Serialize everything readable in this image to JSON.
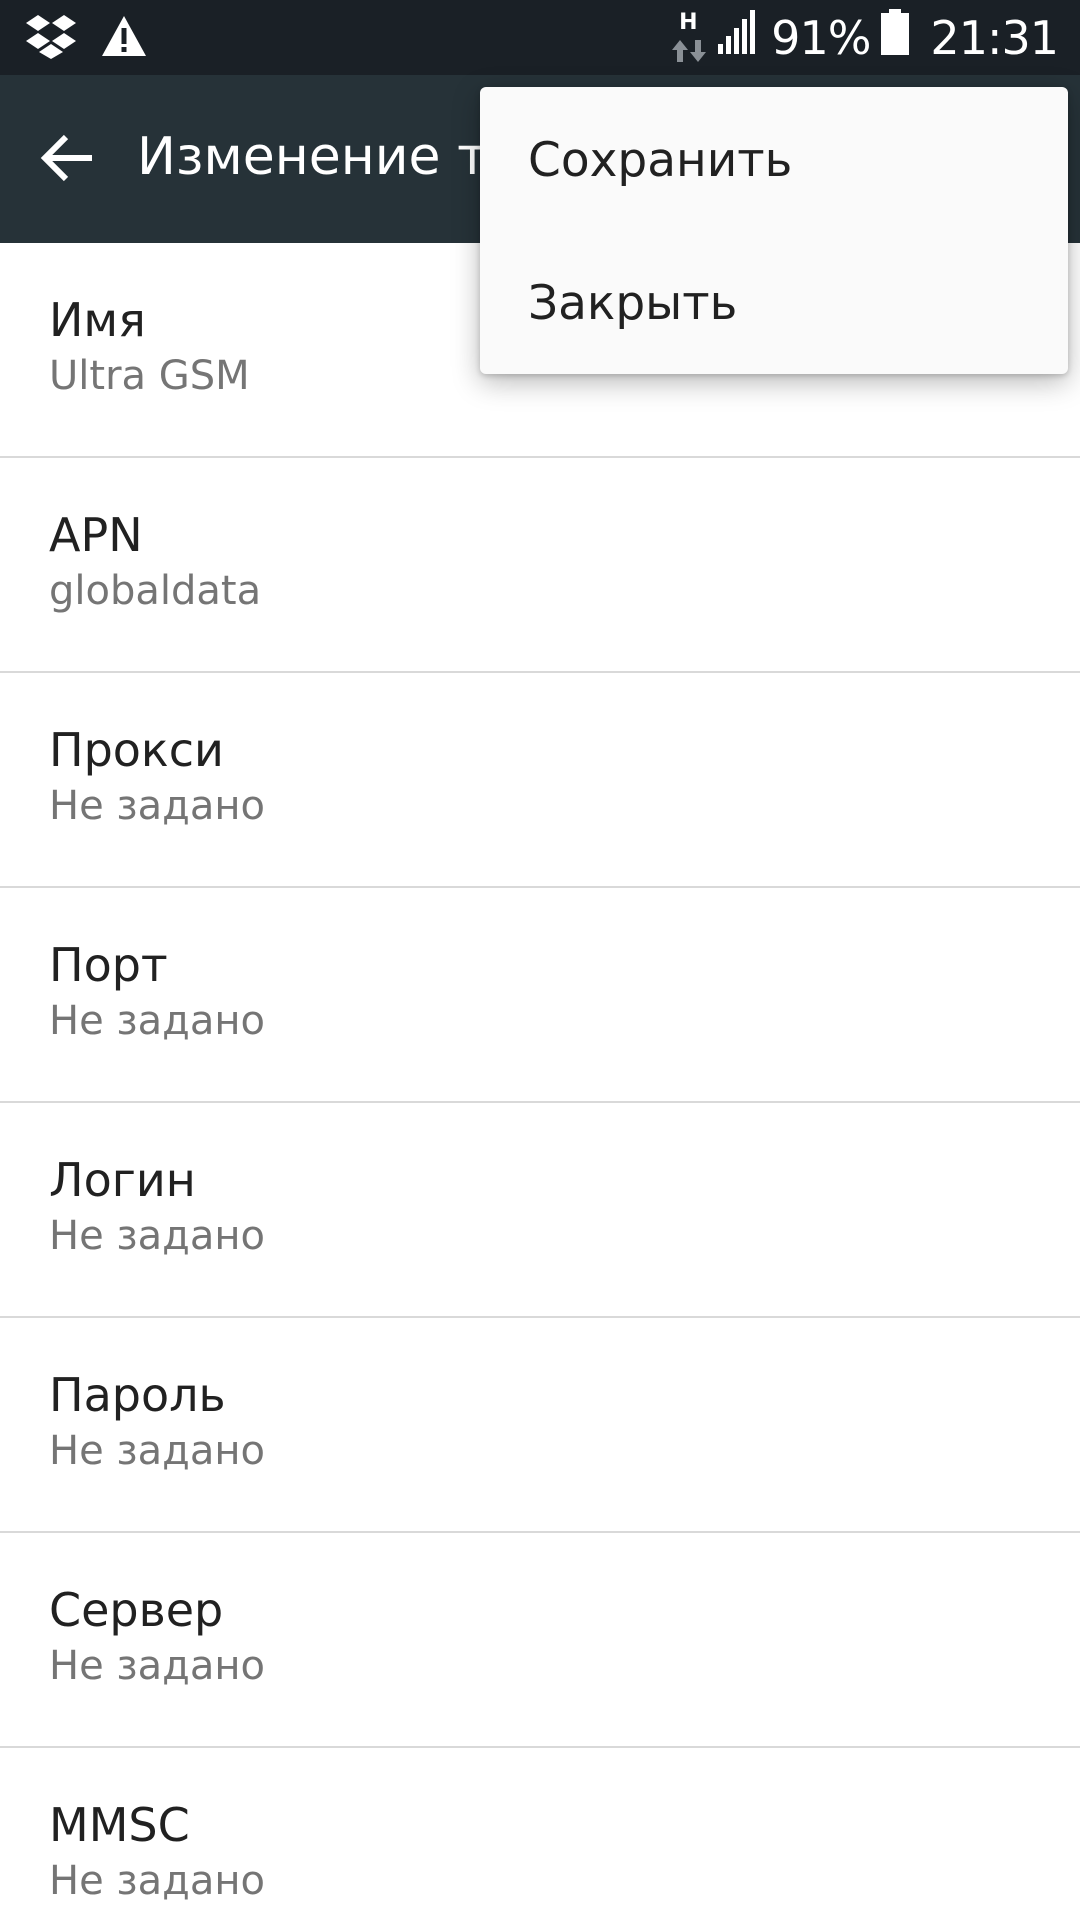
{
  "status_bar": {
    "left_icons": [
      "dropbox-icon",
      "warning-icon"
    ],
    "network_type": "H",
    "battery_percent": "91%",
    "time": "21:31"
  },
  "app_bar": {
    "title": "Изменение точки доступа",
    "back_icon": "arrow-back-icon"
  },
  "overflow_menu": {
    "items": [
      {
        "label": "Сохранить"
      },
      {
        "label": "Закрыть"
      }
    ]
  },
  "fields": [
    {
      "label": "Имя",
      "value": "Ultra GSM"
    },
    {
      "label": "APN",
      "value": "globaldata"
    },
    {
      "label": "Прокси",
      "value": "Не задано"
    },
    {
      "label": "Порт",
      "value": "Не задано"
    },
    {
      "label": "Логин",
      "value": "Не задано"
    },
    {
      "label": "Пароль",
      "value": "Не задано"
    },
    {
      "label": "Сервер",
      "value": "Не задано"
    },
    {
      "label": "MMSC",
      "value": "Не задано"
    }
  ],
  "colors": {
    "status_bar": "#1a2026",
    "app_bar": "#263238",
    "menu_bg": "#fafafa",
    "divider": "#d9d9d9",
    "secondary_text": "#757575"
  }
}
